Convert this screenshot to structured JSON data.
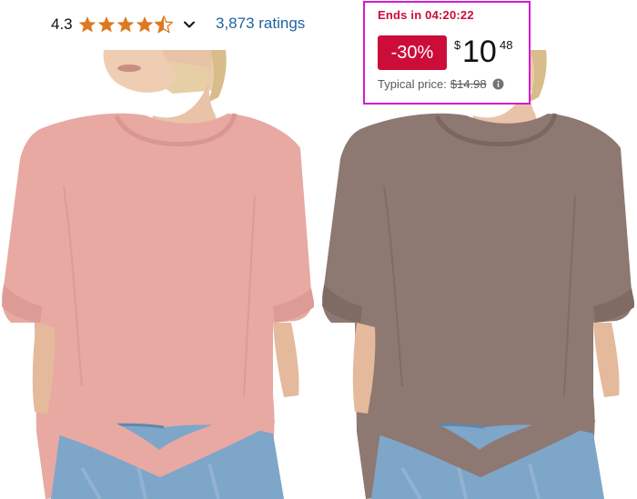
{
  "rating": {
    "value": "4.3",
    "stars": 4.3,
    "ratings_link": "3,873 ratings"
  },
  "deal": {
    "timer": "Ends in 04:20:22",
    "discount": "-30%",
    "price_symbol": "$",
    "price_whole": "10",
    "price_fraction": "48",
    "typical_label": "Typical price:",
    "typical_price": "$14.98"
  },
  "products": [
    {
      "color_name": "pink",
      "shirt_color": "#e8a9a3"
    },
    {
      "color_name": "mocha",
      "shirt_color": "#8e7872"
    }
  ],
  "colors": {
    "star": "#de7921",
    "link": "#2162a1",
    "deal_red": "#cc0c39",
    "highlight": "#d41ad4"
  }
}
